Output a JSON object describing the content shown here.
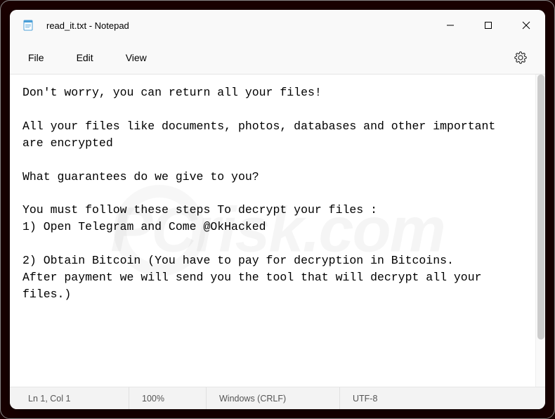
{
  "titlebar": {
    "title": "read_it.txt - Notepad"
  },
  "menu": {
    "file": "File",
    "edit": "Edit",
    "view": "View"
  },
  "editor": {
    "content": "Don't worry, you can return all your files!\n\nAll your files like documents, photos, databases and other important are encrypted\n\nWhat guarantees do we give to you?\n\nYou must follow these steps To decrypt your files :\n1) Open Telegram and Come @OkHacked\n\n2) Obtain Bitcoin (You have to pay for decryption in Bitcoins.\nAfter payment we will send you the tool that will decrypt all your files.)"
  },
  "statusbar": {
    "position": "Ln 1, Col 1",
    "zoom": "100%",
    "line_ending": "Windows (CRLF)",
    "encoding": "UTF-8"
  }
}
